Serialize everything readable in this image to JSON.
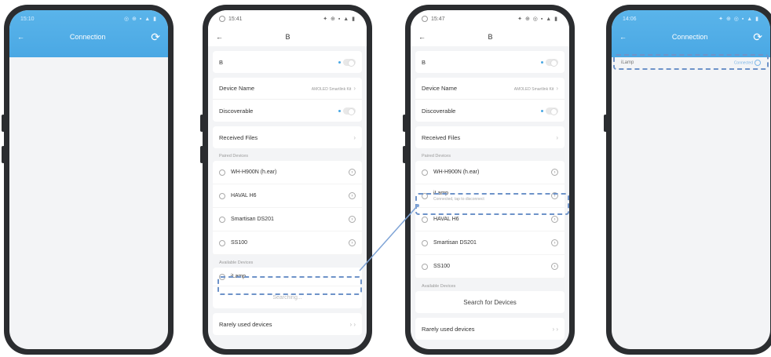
{
  "phone1": {
    "status": {
      "time": "15:10",
      "icons": "◎ ⊕  ▪ ▲ ▮"
    },
    "nav": {
      "back": "←",
      "title": "Connection",
      "refresh": "⟳"
    }
  },
  "phone2": {
    "status": {
      "time": "15:41",
      "icons": "✦ ⊕  ▪ ▲ ▮"
    },
    "nav": {
      "back": "←",
      "title": "B"
    },
    "bt_label": "B",
    "device_name_label": "Device Name",
    "device_name_value": "AMOLED Smartlink Kit",
    "discoverable_label": "Discoverable",
    "received_files_label": "Received Files",
    "paired_header": "Paired Devices",
    "paired": [
      "WH-H900N (h.ear)",
      "HAVAL H6",
      "Smartisan DS201",
      "SS100"
    ],
    "available_header": "Available Devices",
    "available": [
      "iLamp"
    ],
    "searching": "Searching...",
    "rarely_used": "Rarely used devices"
  },
  "phone3": {
    "status": {
      "time": "15:47",
      "icons": "✦ ⊕ ◎ ▪ ▲ ▮"
    },
    "nav": {
      "back": "←",
      "title": "B"
    },
    "bt_label": "B",
    "device_name_label": "Device Name",
    "device_name_value": "AMOLED Smartlink Kit",
    "discoverable_label": "Discoverable",
    "received_files_label": "Received Files",
    "paired_header": "Paired Devices",
    "paired_first": "WH-H900N (h.ear)",
    "connected_device": "iLamp",
    "connected_sub": "Connected, tap to disconnect",
    "paired_rest": [
      "HAVAL H6",
      "Smartisan DS201",
      "SS100"
    ],
    "available_header": "Available Devices",
    "search_button": "Search for Devices",
    "rarely_used": "Rarely used devices"
  },
  "phone4": {
    "status": {
      "time": "14:06",
      "icons": "✦ ⊕ ◎ ▪ ▲ ▮"
    },
    "nav": {
      "back": "←",
      "title": "Connection",
      "refresh": "⟳"
    },
    "device": "iLamp",
    "state": "Connected"
  },
  "colors": {
    "accent": "#4aa8e4",
    "highlight": "#6e93c9"
  }
}
